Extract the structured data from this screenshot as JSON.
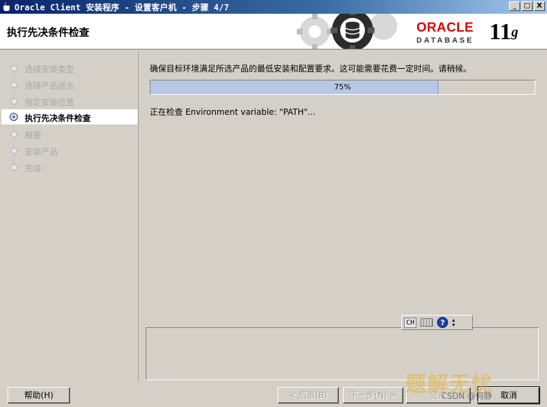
{
  "window": {
    "title": "Oracle Client 安装程序 - 设置客户机 - 步骤 4/7",
    "buttons": {
      "minimize": "_",
      "maximize": "□",
      "close": "X"
    }
  },
  "banner": {
    "step_title": "执行先决条件检查",
    "logo_brand": "ORACLE",
    "logo_product": "DATABASE",
    "version_number": "11",
    "version_letter": "g",
    "brand_color": "#e20000"
  },
  "steps": [
    {
      "label": "选择安装类型",
      "state": "done"
    },
    {
      "label": "选择产品语言",
      "state": "done"
    },
    {
      "label": "指定安装位置",
      "state": "done"
    },
    {
      "label": "执行先决条件检查",
      "state": "current"
    },
    {
      "label": "概要",
      "state": "pending"
    },
    {
      "label": "安装产品",
      "state": "pending"
    },
    {
      "label": "完成",
      "state": "pending"
    }
  ],
  "main": {
    "intro": "确保目标环境满足所选产品的最低安装和配置要求。这可能需要花费一定时间。请稍候。",
    "progress_text": "75%",
    "progress_fraction": 0.75,
    "status": "正在检查 Environment variable: \"PATH\"..."
  },
  "ime": {
    "mode": "CH",
    "keyboard_icon": "keyboard-icon",
    "help": "?"
  },
  "footer": {
    "help_label": "帮助(H)",
    "back_label": "< 后退(B)",
    "next_label": "下一步(N) >",
    "finish_label": "完成",
    "cancel_label": "取消"
  },
  "overlays": {
    "watermark": "题解无忧",
    "csdn_mark": "CSDN @何静"
  }
}
